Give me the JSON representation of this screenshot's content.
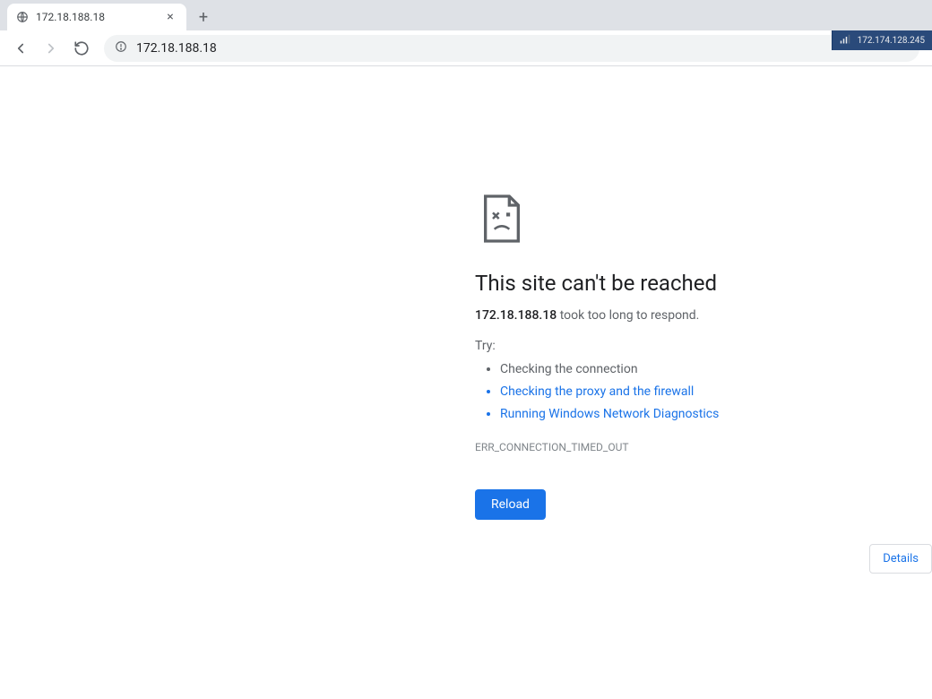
{
  "tab": {
    "title": "172.18.188.18"
  },
  "toolbar": {
    "url": "172.18.188.18"
  },
  "overlay": {
    "ip": "172.174.128.245"
  },
  "error": {
    "title": "This site can't be reached",
    "host": "172.18.188.18",
    "message_suffix": " took too long to respond.",
    "try_label": "Try:",
    "suggestions": {
      "0": "Checking the connection",
      "1": "Checking the proxy and the firewall",
      "2": "Running Windows Network Diagnostics"
    },
    "code": "ERR_CONNECTION_TIMED_OUT",
    "reload_label": "Reload",
    "details_label": "Details"
  }
}
